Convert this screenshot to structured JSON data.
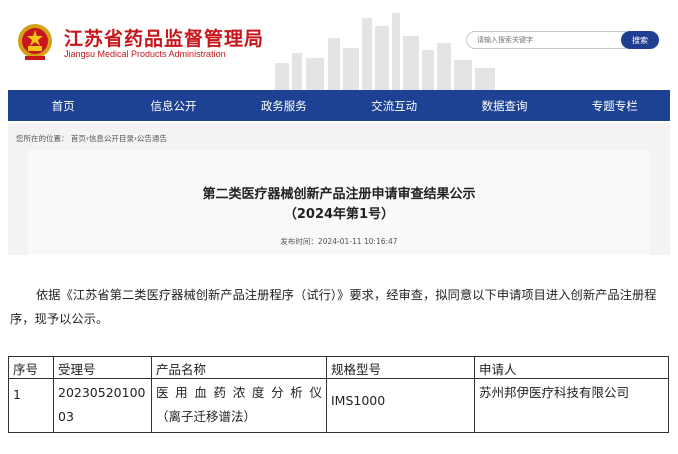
{
  "header": {
    "site_title_cn": "江苏省药品监督管理局",
    "site_title_en": "Jiangsu Medical Products Administration",
    "search_placeholder": "请输入搜索关键字",
    "search_button": "搜索"
  },
  "nav": {
    "items": [
      "首页",
      "信息公开",
      "政务服务",
      "交流互动",
      "数据查询",
      "专题专栏"
    ]
  },
  "breadcrumb": "您所在的位置： 首页›信息公开目录›公告通告",
  "article": {
    "title": "第二类医疗器械创新产品注册申请审查结果公示",
    "subtitle": "（2024年第1号）",
    "publish_time": "发布时间：2024-01-11 10:16:47",
    "paragraph": "依据《江苏省第二类医疗器械创新产品注册程序（试行）》要求，经审查，拟同意以下申请项目进入创新产品注册程序，现予以公示。"
  },
  "table": {
    "headers": [
      "序号",
      "受理号",
      "产品名称",
      "规格型号",
      "申请人"
    ],
    "rows": [
      {
        "index": "1",
        "acceptance_no": "2023052010003",
        "product_name_line1": "医用血药浓度分析仪",
        "product_name_line2": "（离子迁移谱法）",
        "model": "IMS1000",
        "applicant": "苏州邦伊医疗科技有限公司"
      }
    ]
  },
  "colors": {
    "brand_red": "#c8161d",
    "nav_blue": "#1d4193",
    "search_button_blue": "#1e3f8f"
  }
}
